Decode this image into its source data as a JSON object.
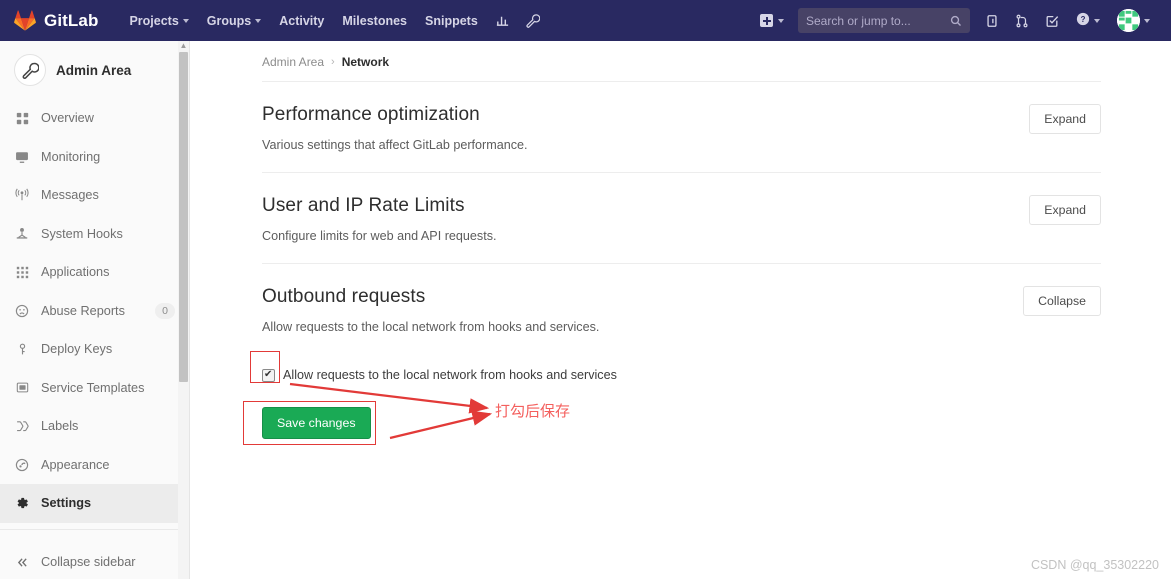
{
  "topnav": {
    "logo_text": "GitLab",
    "logo_icon": "gitlab-tanuki-icon",
    "items": [
      {
        "label": "Projects",
        "icon": "chevron-down-icon",
        "has_caret": true
      },
      {
        "label": "Groups",
        "icon": "chevron-down-icon",
        "has_caret": true
      },
      {
        "label": "Activity",
        "has_caret": false
      },
      {
        "label": "Milestones",
        "has_caret": false
      },
      {
        "label": "Snippets",
        "has_caret": false
      }
    ],
    "icon_buttons": [
      {
        "name": "analytics-icon"
      },
      {
        "name": "wrench-icon"
      }
    ],
    "create_new": {
      "label": "",
      "icon": "plus-square-icon"
    },
    "search": {
      "placeholder": "Search or jump to...",
      "value": "",
      "icon": "search-icon"
    },
    "right_icons": [
      {
        "name": "issues-icon"
      },
      {
        "name": "merge-requests-icon"
      },
      {
        "name": "todos-icon"
      },
      {
        "name": "help-icon"
      }
    ],
    "avatar": {
      "name": "user-avatar"
    },
    "bg_color": "#292961"
  },
  "sidebar": {
    "title": "Admin Area",
    "title_icon": "wrench-icon",
    "items": [
      {
        "label": "Overview",
        "icon": "grid-icon",
        "active": false,
        "badge": null
      },
      {
        "label": "Monitoring",
        "icon": "monitor-icon",
        "active": false,
        "badge": null
      },
      {
        "label": "Messages",
        "icon": "broadcast-icon",
        "active": false,
        "badge": null
      },
      {
        "label": "System Hooks",
        "icon": "hook-icon",
        "active": false,
        "badge": null
      },
      {
        "label": "Applications",
        "icon": "applications-icon",
        "active": false,
        "badge": null
      },
      {
        "label": "Abuse Reports",
        "icon": "abuse-icon",
        "active": false,
        "badge": "0"
      },
      {
        "label": "Deploy Keys",
        "icon": "key-icon",
        "active": false,
        "badge": null
      },
      {
        "label": "Service Templates",
        "icon": "template-icon",
        "active": false,
        "badge": null
      },
      {
        "label": "Labels",
        "icon": "labels-icon",
        "active": false,
        "badge": null
      },
      {
        "label": "Appearance",
        "icon": "appearance-icon",
        "active": false,
        "badge": null
      },
      {
        "label": "Settings",
        "icon": "gear-icon",
        "active": true,
        "badge": null
      }
    ],
    "collapse": {
      "label": "Collapse sidebar",
      "icon": "double-chevron-left-icon"
    }
  },
  "breadcrumb": {
    "root": "Admin Area",
    "separator": "›",
    "current": "Network"
  },
  "sections": [
    {
      "title": "Performance optimization",
      "description": "Various settings that affect GitLab performance.",
      "button": "Expand"
    },
    {
      "title": "User and IP Rate Limits",
      "description": "Configure limits for web and API requests.",
      "button": "Expand"
    },
    {
      "title": "Outbound requests",
      "description": "Allow requests to the local network from hooks and services.",
      "button": "Collapse"
    }
  ],
  "form": {
    "checkbox_label": "Allow requests to the local network from hooks and services",
    "checkbox_checked": true,
    "save_label": "Save changes",
    "save_color": "#1aaa55"
  },
  "annotations": {
    "text": "打勾后保存",
    "color": "#e23a38"
  },
  "watermark": "CSDN @qq_35302220"
}
